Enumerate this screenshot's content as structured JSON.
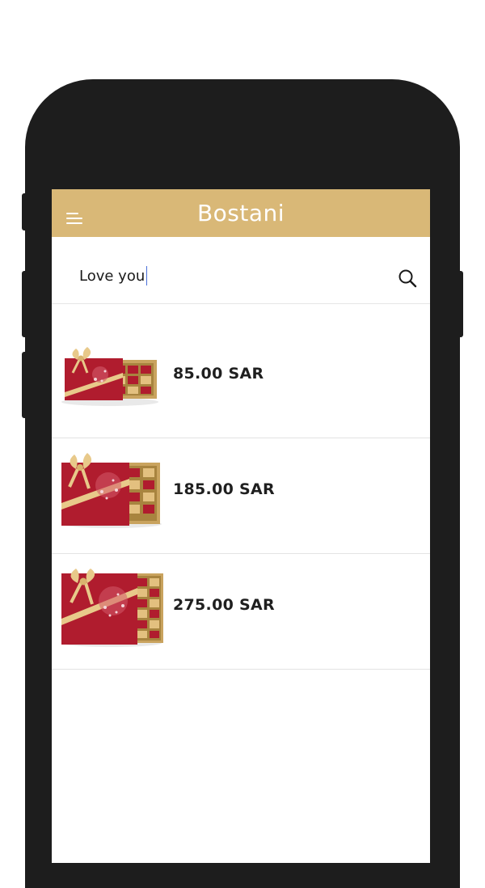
{
  "app": {
    "title": "Bostani"
  },
  "search": {
    "value": "Love you",
    "placeholder": ""
  },
  "results": [
    {
      "price": "85.00 SAR",
      "image": "small-red-chocolate-gift-box"
    },
    {
      "price": "185.00 SAR",
      "image": "medium-red-chocolate-gift-box"
    },
    {
      "price": "275.00 SAR",
      "image": "large-red-chocolate-gift-box"
    }
  ],
  "colors": {
    "header": "#d9b877",
    "frame": "#1d1d1d",
    "box_red": "#b01c2e",
    "ribbon_gold": "#e8c98a"
  },
  "icons": {
    "menu": "menu-icon",
    "search": "search-icon"
  }
}
